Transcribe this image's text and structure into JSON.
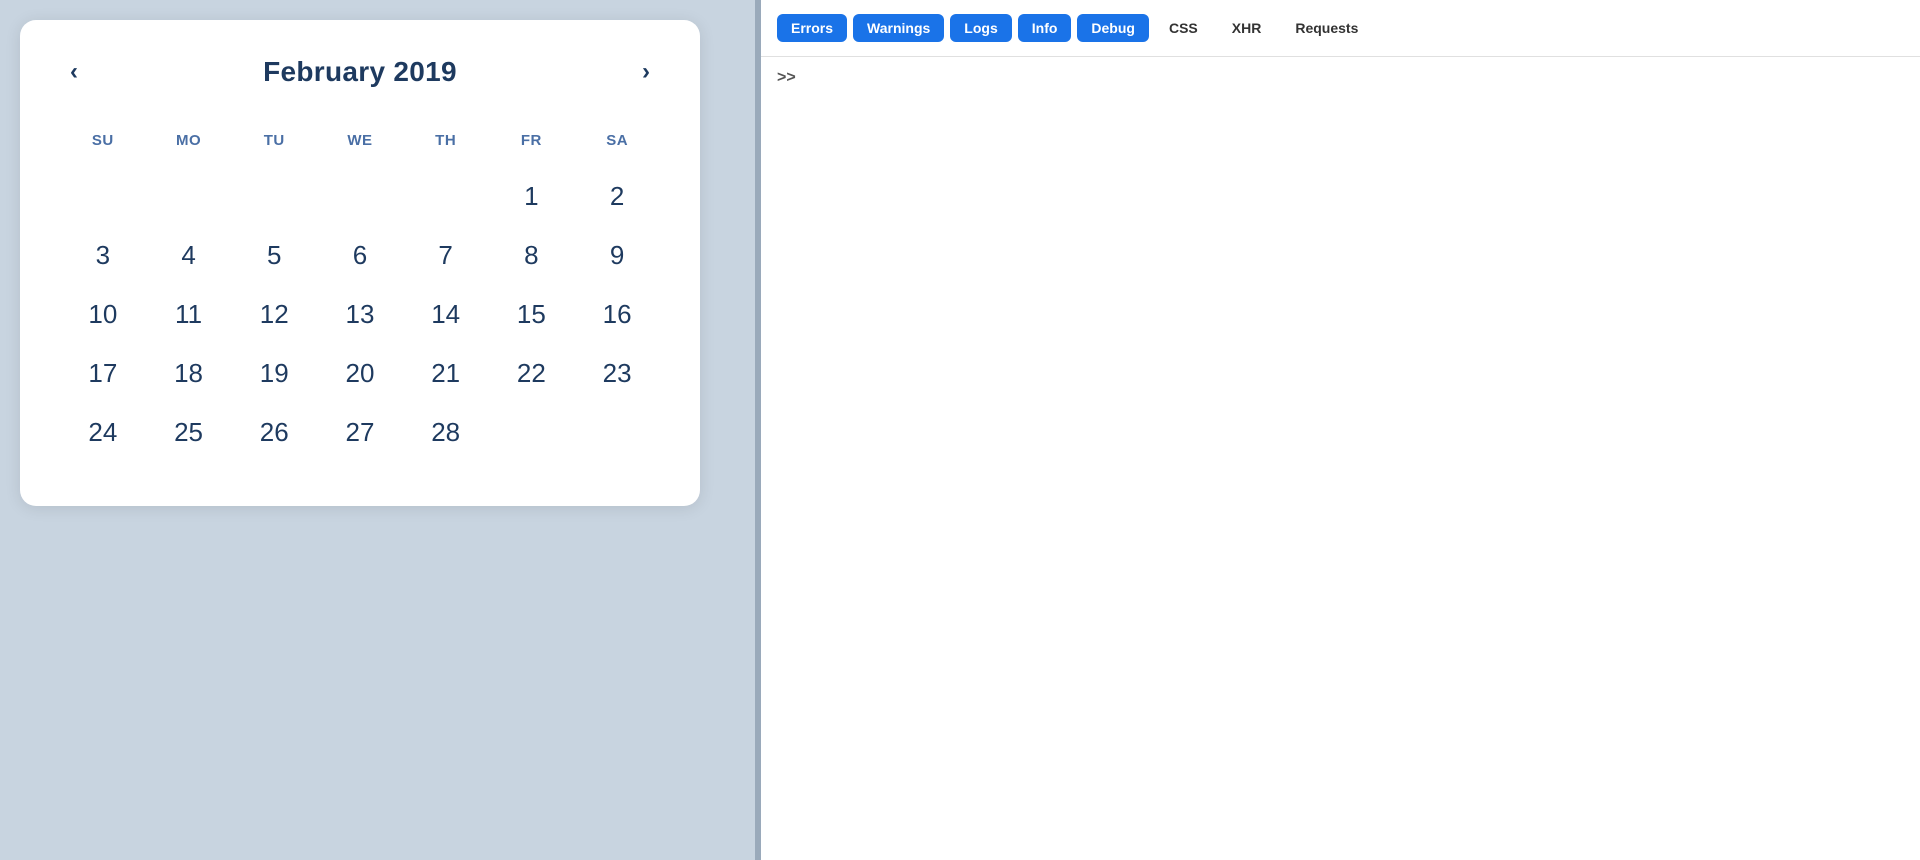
{
  "calendar": {
    "title": "February 2019",
    "prev_label": "‹",
    "next_label": "›",
    "day_headers": [
      "Su",
      "Mo",
      "Tu",
      "We",
      "Th",
      "Fr",
      "Sa"
    ],
    "weeks": [
      [
        null,
        null,
        null,
        null,
        null,
        1,
        2
      ],
      [
        3,
        4,
        5,
        6,
        7,
        8,
        9
      ],
      [
        10,
        11,
        12,
        13,
        14,
        15,
        16
      ],
      [
        17,
        18,
        19,
        20,
        21,
        22,
        23
      ],
      [
        24,
        25,
        26,
        27,
        28,
        null,
        null
      ]
    ]
  },
  "devtools": {
    "filters": [
      {
        "label": "Errors",
        "active": true
      },
      {
        "label": "Warnings",
        "active": true
      },
      {
        "label": "Logs",
        "active": true
      },
      {
        "label": "Info",
        "active": true
      },
      {
        "label": "Debug",
        "active": true
      },
      {
        "label": "CSS",
        "active": false
      },
      {
        "label": "XHR",
        "active": false
      },
      {
        "label": "Requests",
        "active": false
      }
    ],
    "console_prompt": ">>"
  }
}
